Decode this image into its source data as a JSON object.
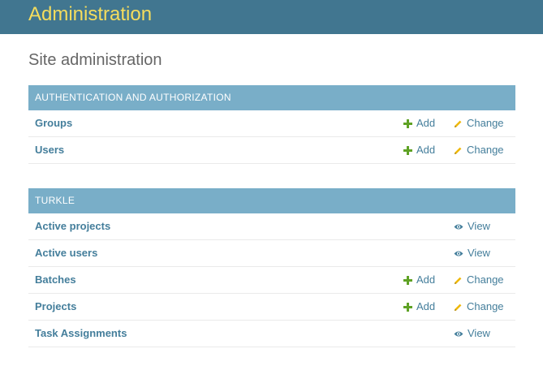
{
  "header": {
    "site_title": "Administration"
  },
  "page_title": "Site administration",
  "modules": [
    {
      "caption": "AUTHENTICATION AND AUTHORIZATION",
      "rows": [
        {
          "name": "Groups",
          "add": "Add",
          "change": "Change"
        },
        {
          "name": "Users",
          "add": "Add",
          "change": "Change"
        }
      ]
    },
    {
      "caption": "TURKLE",
      "rows": [
        {
          "name": "Active projects",
          "view": "View"
        },
        {
          "name": "Active users",
          "view": "View"
        },
        {
          "name": "Batches",
          "add": "Add",
          "change": "Change"
        },
        {
          "name": "Projects",
          "add": "Add",
          "change": "Change"
        },
        {
          "name": "Task Assignments",
          "view": "View"
        }
      ]
    }
  ],
  "colors": {
    "header_bg": "#417690",
    "title_yellow": "#f5dd5d",
    "module_header_bg": "#79aec8",
    "link": "#447e9b",
    "add_green": "#5fa225",
    "change_yellow": "#efb80b"
  },
  "icons": {
    "add": "plus-icon",
    "change": "pencil-icon",
    "view": "eye-icon"
  }
}
